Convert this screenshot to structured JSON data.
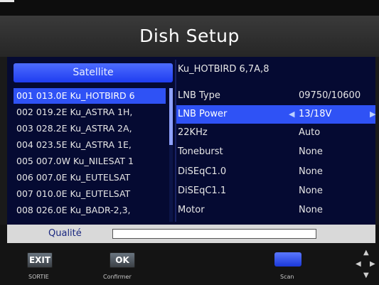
{
  "screen": {
    "title": "Dish Setup"
  },
  "satellites": {
    "header": "Satellite",
    "items": [
      "001 013.0E Ku_HOTBIRD 6",
      "002 019.2E Ku_ASTRA 1H,",
      "003 028.2E Ku_ASTRA 2A,",
      "004 023.5E Ku_ASTRA 1E,",
      "005 007.0W Ku_NILESAT 1",
      "006 007.0E Ku_EUTELSAT",
      "007 010.0E Ku_EUTELSAT",
      "008 026.0E Ku_BADR-2,3,"
    ],
    "selected_index": 0
  },
  "settings": {
    "satellite_name": "Ku_HOTBIRD 6,7A,8",
    "rows": [
      {
        "label": "LNB Type",
        "value": "09750/10600"
      },
      {
        "label": "LNB Power",
        "value": "13/18V"
      },
      {
        "label": "22KHz",
        "value": "Auto"
      },
      {
        "label": "Toneburst",
        "value": "None"
      },
      {
        "label": "DiSEqC1.0",
        "value": "None"
      },
      {
        "label": "DiSEqC1.1",
        "value": "None"
      },
      {
        "label": "Motor",
        "value": "None"
      }
    ],
    "selected_index": 1
  },
  "quality": {
    "label": "Qualité",
    "level": 0
  },
  "footer": {
    "exit_key": "EXIT",
    "exit_caption": "SORTIE",
    "ok_key": "OK",
    "ok_caption": "Confirmer",
    "scan_caption": "Scan"
  },
  "colors": {
    "accent_blue": "#2f52f5",
    "panel_navy": "#050a32",
    "quality_bg": "#d9d9d9"
  },
  "icons": [
    "left-arrow-icon",
    "right-arrow-icon",
    "dpad-icon"
  ]
}
